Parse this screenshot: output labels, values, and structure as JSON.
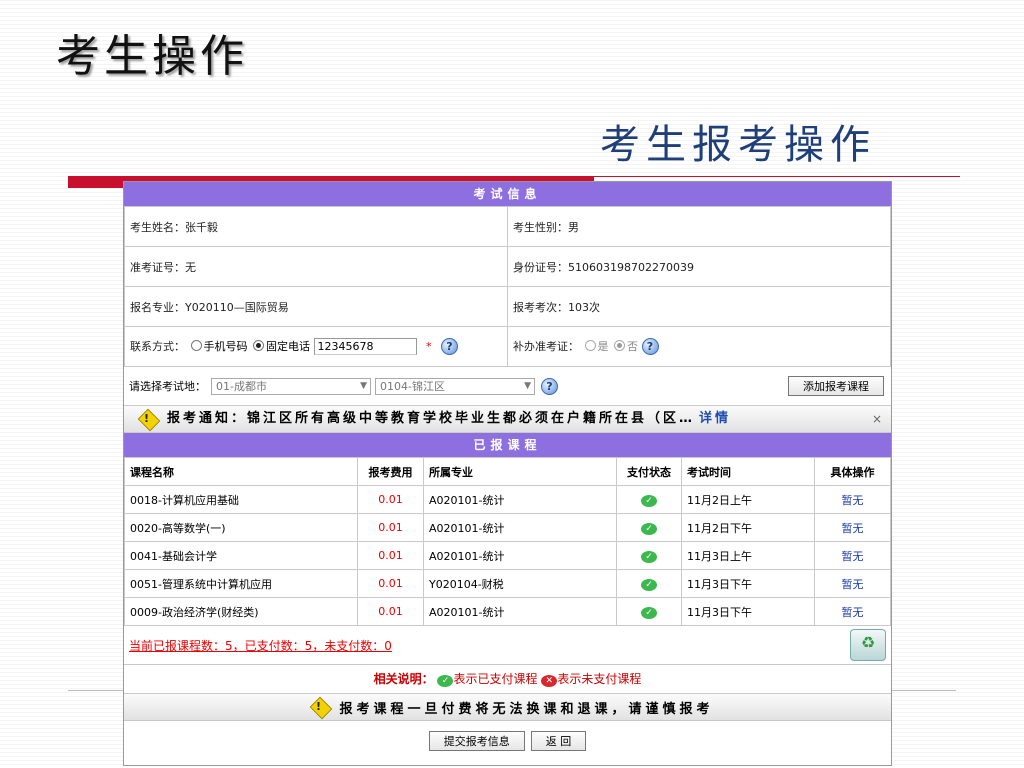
{
  "slide": {
    "title": "考生操作",
    "subtitle": "考生报考操作"
  },
  "exam_info": {
    "header": "考试信息",
    "name_label": "考生姓名：",
    "name_value": "张千毅",
    "gender_label": "考生性别：",
    "gender_value": "男",
    "admit_label": "准考证号：",
    "admit_value": "无",
    "id_label": "身份证号：",
    "id_value": "510603198702270039",
    "major_label": "报名专业：",
    "major_value": "Y020110—国际贸易",
    "count_label": "报考考次：",
    "count_value": "103次",
    "contact_label": "联系方式：",
    "contact_options": [
      "手机号码",
      "固定电话"
    ],
    "contact_selected": "固定电话",
    "phone_value": "12345678",
    "required_mark": "*",
    "reissue_label": "补办准考证：",
    "reissue_options": [
      "是",
      "否"
    ],
    "reissue_selected": "否"
  },
  "exam_site": {
    "label": "请选择考试地：",
    "city_selected": "01-成都市",
    "district_selected": "0104-锦江区",
    "add_button": "添加报考课程"
  },
  "notice": {
    "text": "报考通知：锦江区所有高级中等教育学校毕业生都必须在户籍所在县（区…",
    "detail_link": "详情",
    "close": "×"
  },
  "courses": {
    "header": "已报课程",
    "columns": [
      "课程名称",
      "报考费用",
      "所属专业",
      "支付状态",
      "考试时间",
      "具体操作"
    ],
    "rows": [
      {
        "name": "0018-计算机应用基础",
        "fee": "0.01",
        "major": "A020101-统计",
        "paid": true,
        "time": "11月2日上午",
        "action": "暂无"
      },
      {
        "name": "0020-高等数学(一)",
        "fee": "0.01",
        "major": "A020101-统计",
        "paid": true,
        "time": "11月2日下午",
        "action": "暂无"
      },
      {
        "name": "0041-基础会计学",
        "fee": "0.01",
        "major": "A020101-统计",
        "paid": true,
        "time": "11月3日上午",
        "action": "暂无"
      },
      {
        "name": "0051-管理系统中计算机应用",
        "fee": "0.01",
        "major": "Y020104-财税",
        "paid": true,
        "time": "11月3日下午",
        "action": "暂无"
      },
      {
        "name": "0009-政治经济学(财经类)",
        "fee": "0.01",
        "major": "A020101-统计",
        "paid": true,
        "time": "11月3日下午",
        "action": "暂无"
      }
    ],
    "summary": "当前已报课程数：5，已支付数：5，未支付数：0"
  },
  "explanation": {
    "label": "相关说明：",
    "paid_text": "表示已支付课程",
    "unpaid_text": "表示未支付课程"
  },
  "footer": {
    "warning": "报考课程一旦付费将无法换课和退课，请谨慎报考",
    "submit_button": "提交报考信息",
    "back_button": "返 回"
  },
  "colors": {
    "section_header": "#8e6fe0",
    "accent_red": "#c8102e",
    "fee_red": "#ee0000",
    "paid_green": "#3cb94e",
    "link_blue": "#1a3aa8"
  }
}
